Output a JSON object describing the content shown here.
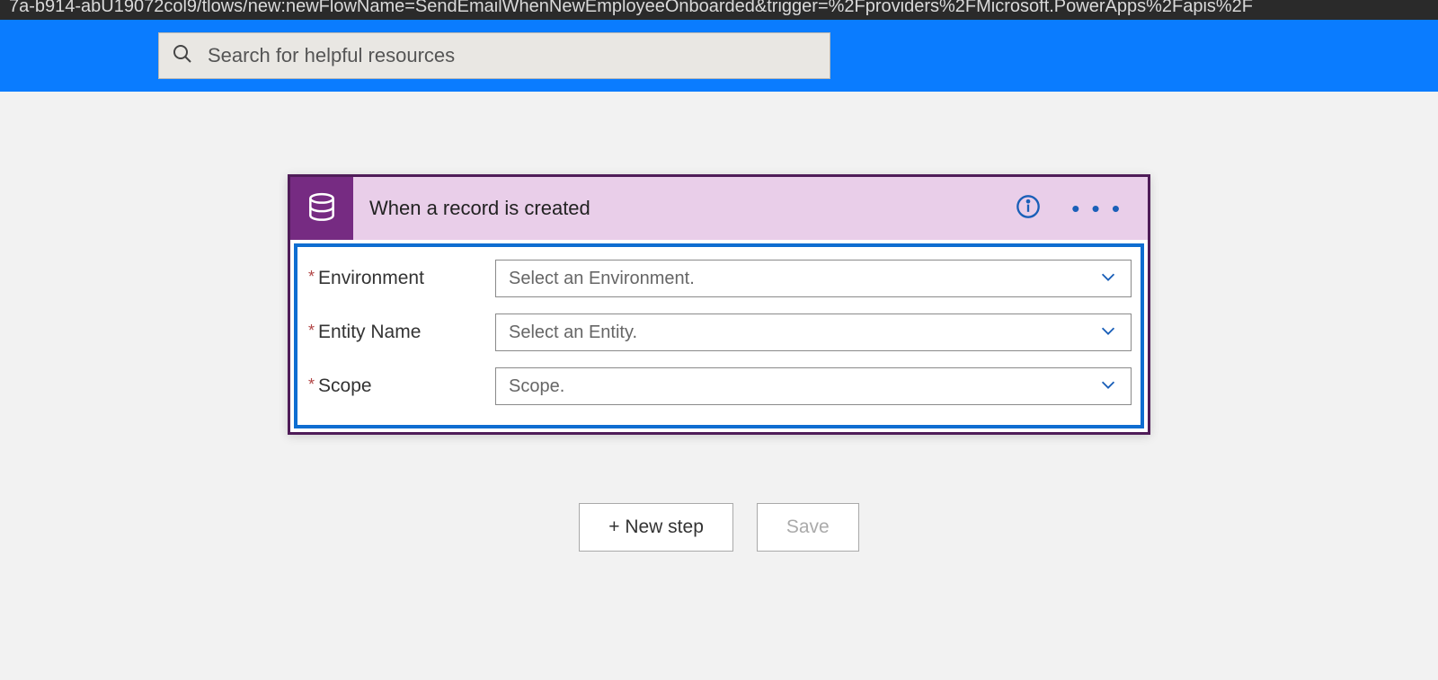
{
  "urlbar": "7a-b914-abU19072col9/tlows/new:newFlowName=SendEmailWhenNewEmployeeOnboarded&trigger=%2Fproviders%2FMicrosoft.PowerApps%2Fapis%2F",
  "search": {
    "placeholder": "Search for helpful resources"
  },
  "card": {
    "title": "When a record is created",
    "fields": [
      {
        "label": "Environment",
        "placeholder": "Select an Environment."
      },
      {
        "label": "Entity Name",
        "placeholder": "Select an Entity."
      },
      {
        "label": "Scope",
        "placeholder": "Scope."
      }
    ]
  },
  "actions": {
    "newstep": "+ New step",
    "save": "Save"
  },
  "req_marker": "*"
}
